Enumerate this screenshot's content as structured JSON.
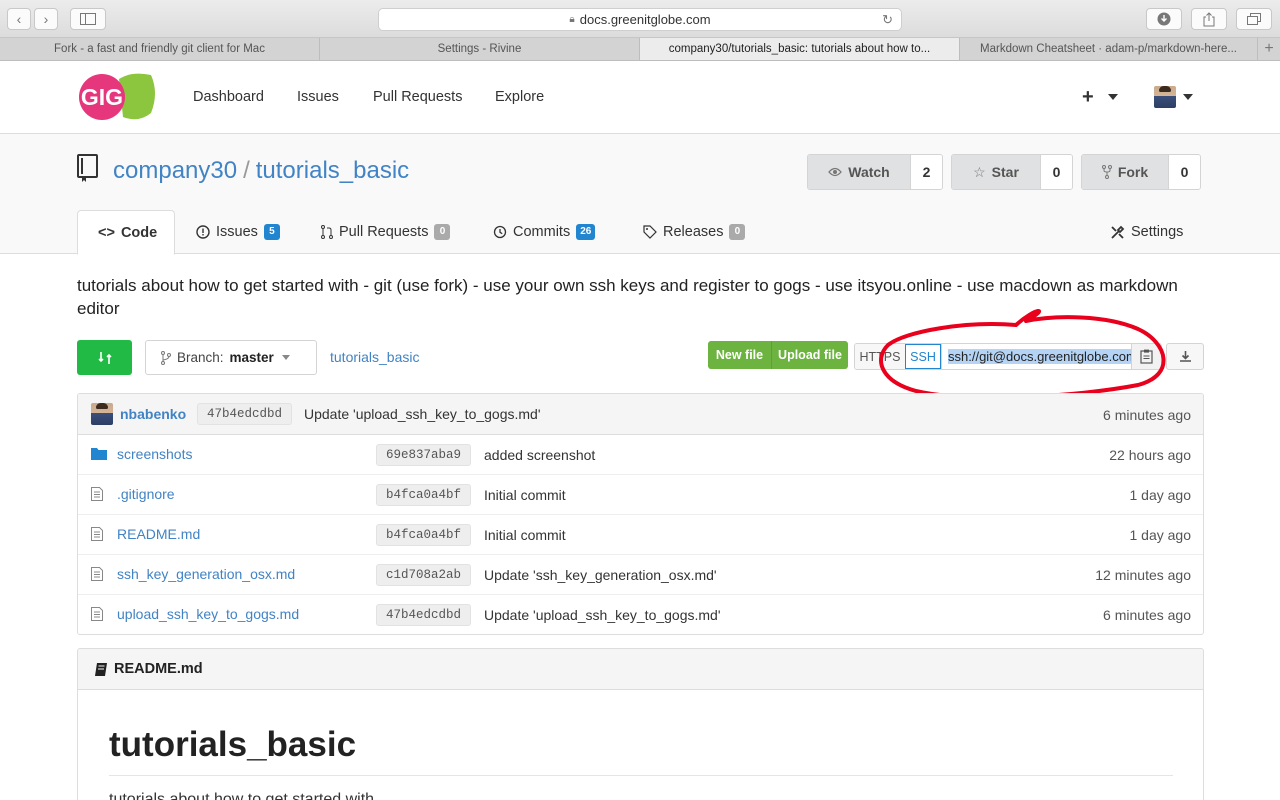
{
  "browser": {
    "url": "docs.greenitglobe.com",
    "tabs": [
      {
        "title": "Fork - a fast and friendly git client for Mac"
      },
      {
        "title": "Settings - Rivine"
      },
      {
        "title": "company30/tutorials_basic: tutorials about how to..."
      },
      {
        "title": "Markdown Cheatsheet · adam-p/markdown-here..."
      }
    ]
  },
  "header": {
    "logo_text": "GIG",
    "nav": [
      "Dashboard",
      "Issues",
      "Pull Requests",
      "Explore"
    ],
    "plus": "+"
  },
  "repo": {
    "owner": "company30",
    "separator": "/",
    "name": "tutorials_basic",
    "watch": {
      "label": "Watch",
      "count": "2"
    },
    "star": {
      "label": "Star",
      "count": "0"
    },
    "fork": {
      "label": "Fork",
      "count": "0"
    },
    "tabs": [
      {
        "label": "Code"
      },
      {
        "label": "Issues",
        "badge": "5"
      },
      {
        "label": "Pull Requests",
        "badge": "0"
      },
      {
        "label": "Commits",
        "badge": "26"
      },
      {
        "label": "Releases",
        "badge": "0"
      }
    ],
    "settings": "Settings",
    "description": "tutorials about how to get started with - git (use fork) - use your own ssh keys and register to gogs - use itsyou.online - use macdown as markdown editor"
  },
  "toolbar": {
    "branch_prefix": "Branch:",
    "branch": "master",
    "breadcrumb": "tutorials_basic",
    "new_file": "New file",
    "upload_file": "Upload file",
    "https": "HTTPS",
    "ssh": "SSH",
    "clone_url": "ssh://git@docs.greenitglobe.com:"
  },
  "latest_commit": {
    "author": "nbabenko",
    "sha": "47b4edcdbd",
    "message": "Update 'upload_ssh_key_to_gogs.md'",
    "time": "6 minutes ago"
  },
  "files": [
    {
      "name": "screenshots",
      "type": "folder",
      "sha": "69e837aba9",
      "message": "added screenshot",
      "time": "22 hours ago"
    },
    {
      "name": ".gitignore",
      "type": "file",
      "sha": "b4fca0a4bf",
      "message": "Initial commit",
      "time": "1 day ago"
    },
    {
      "name": "README.md",
      "type": "file",
      "sha": "b4fca0a4bf",
      "message": "Initial commit",
      "time": "1 day ago"
    },
    {
      "name": "ssh_key_generation_osx.md",
      "type": "file",
      "sha": "c1d708a2ab",
      "message": "Update 'ssh_key_generation_osx.md'",
      "time": "12 minutes ago"
    },
    {
      "name": "upload_ssh_key_to_gogs.md",
      "type": "file",
      "sha": "47b4edcdbd",
      "message": "Update 'upload_ssh_key_to_gogs.md'",
      "time": "6 minutes ago"
    }
  ],
  "readme": {
    "filename": "README.md",
    "heading": "tutorials_basic",
    "first_line": "tutorials about how to get started with"
  },
  "colors": {
    "link": "#4183c4",
    "green": "#21ba45",
    "upload_green": "#6cb33f",
    "badge_blue": "#2185d0",
    "annotation_red": "#e8001c"
  }
}
